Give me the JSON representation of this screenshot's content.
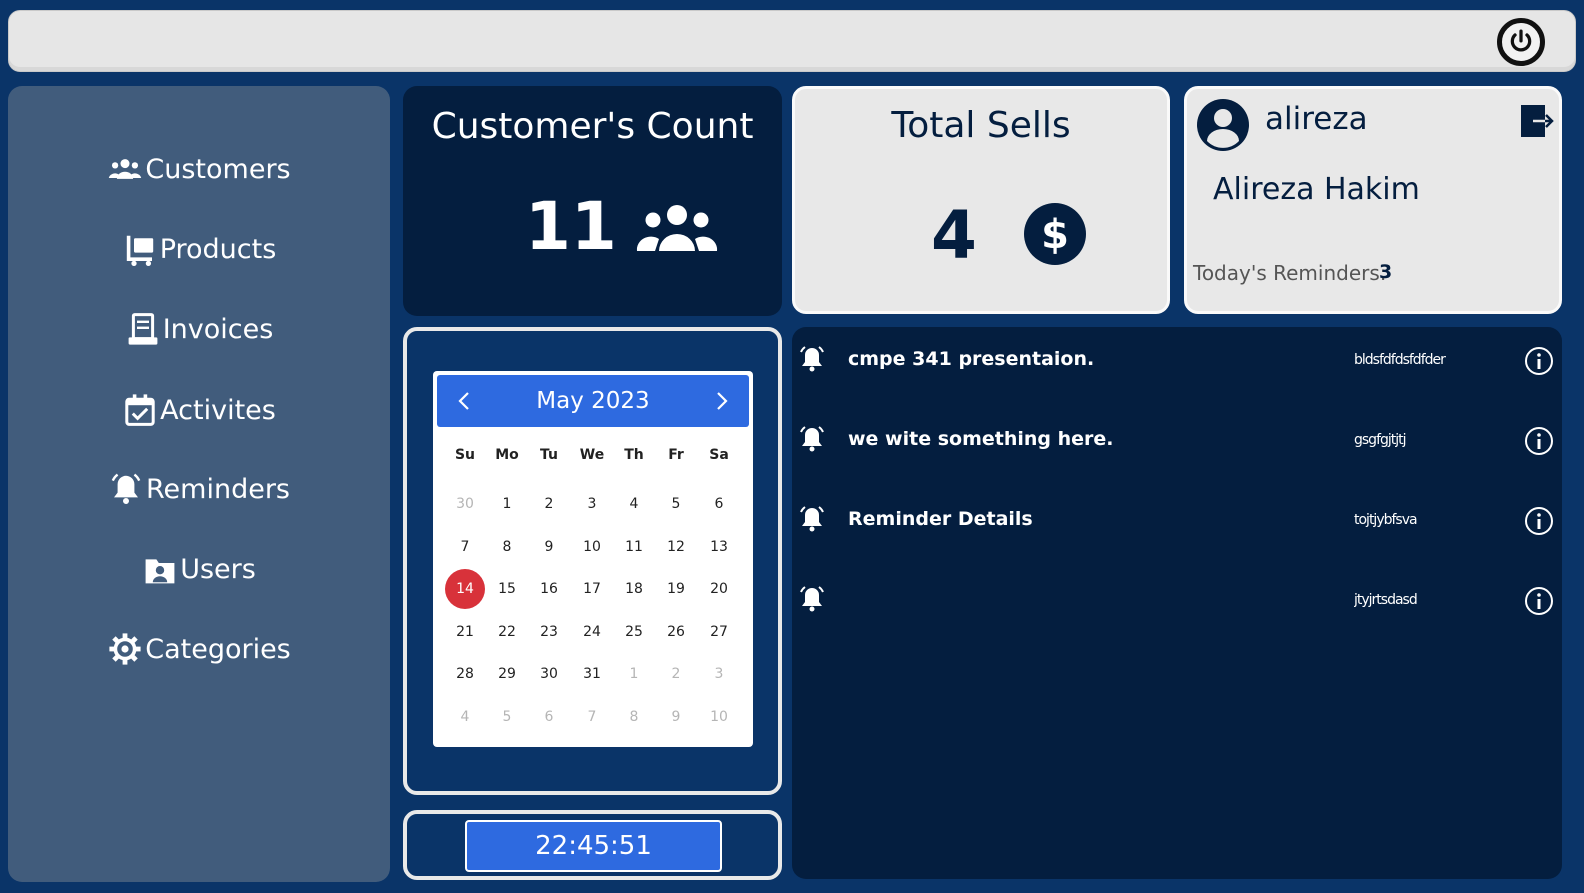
{
  "nav": {
    "customers": "Customers",
    "products": "Products",
    "invoices": "Invoices",
    "activities": "Activites",
    "reminders": "Reminders",
    "users": "Users",
    "categories": "Categories"
  },
  "customers_card": {
    "title": "Customer's Count",
    "value": "11"
  },
  "sells_card": {
    "title": "Total Sells",
    "value": "4"
  },
  "user_card": {
    "username": "alireza",
    "full_name": "Alireza Hakim",
    "reminders_label": "Today's Reminders:",
    "reminders_count": "3"
  },
  "calendar": {
    "month_label": "May 2023",
    "weekdays": [
      "Su",
      "Mo",
      "Tu",
      "We",
      "Th",
      "Fr",
      "Sa"
    ],
    "days": [
      [
        "30",
        "1",
        "2",
        "3",
        "4",
        "5",
        "6"
      ],
      [
        "7",
        "8",
        "9",
        "10",
        "11",
        "12",
        "13"
      ],
      [
        "14",
        "15",
        "16",
        "17",
        "18",
        "19",
        "20"
      ],
      [
        "21",
        "22",
        "23",
        "24",
        "25",
        "26",
        "27"
      ],
      [
        "28",
        "29",
        "30",
        "31",
        "1",
        "2",
        "3"
      ],
      [
        "4",
        "5",
        "6",
        "7",
        "8",
        "9",
        "10"
      ]
    ],
    "selected_day": "14"
  },
  "clock": {
    "time": "22:45:51"
  },
  "reminders": [
    {
      "title": "cmpe 341 presentaion.",
      "description": "bldsfdfdsfdfder"
    },
    {
      "title": "we wite something here.",
      "description": "gsgfgjtjtj"
    },
    {
      "title": "Reminder Details",
      "description": "tojtjybfsva"
    },
    {
      "title": "",
      "description": "jtyjrtsdasd"
    }
  ],
  "colors": {
    "background": "#0a3468",
    "sidebar": "#415c7c",
    "dark_card": "#041e3f",
    "light_card": "#e8e8e8",
    "accent_blue": "#2e6ae0",
    "today_red": "#d8323a"
  }
}
